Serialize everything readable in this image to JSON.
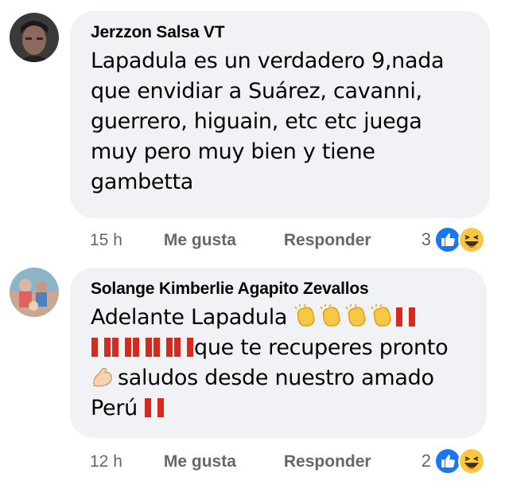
{
  "comments": [
    {
      "author": "Jerzzon Salsa VT",
      "text_lines": [
        "Lapadula es un verdadero 9,nada",
        "que envidiar a Suárez, cavanni,",
        "guerrero, higuain, etc etc juega",
        "muy pero muy bien y tiene",
        "gambetta"
      ],
      "time": "15 h",
      "like_label": "Me gusta",
      "reply_label": "Responder",
      "reaction_count": "3",
      "reactions": [
        "like-icon",
        "haha-icon"
      ]
    },
    {
      "author": "Solange Kimberlie Agapito Zevallos",
      "text_line1": "Adelante Lapadula",
      "text_line2": "que te recuperes pronto",
      "text_line3": "saludos desde nuestro amado",
      "text_line4": "Perú",
      "time": "12 h",
      "like_label": "Me gusta",
      "reply_label": "Responder",
      "reaction_count": "2",
      "reactions": [
        "like-icon",
        "haha-icon"
      ]
    }
  ],
  "colors": {
    "bubble": "#f0f2f5",
    "meta_text": "#65676b",
    "like_blue": "#1877f2",
    "peru_red": "#d52b1e",
    "clap_yellow": "#f7c843"
  }
}
